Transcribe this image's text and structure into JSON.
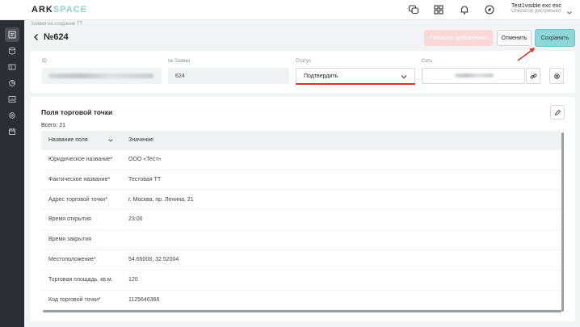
{
  "header": {
    "logo_main": "ARK",
    "logo_accent": "SPACE",
    "user_name": "Test1visible exc exc",
    "user_role": "Оператор дистрибьютора"
  },
  "sidebar": {
    "items": [
      {
        "icon": "list-icon",
        "active": true
      },
      {
        "icon": "database-icon",
        "active": false
      },
      {
        "icon": "layout-icon",
        "active": false
      },
      {
        "icon": "chart-icon",
        "active": false
      },
      {
        "icon": "report-icon",
        "active": false
      },
      {
        "icon": "settings-icon",
        "active": false
      },
      {
        "icon": "calendar-icon",
        "active": false
      }
    ]
  },
  "page": {
    "breadcrumb": "Заявки на создание ТТ",
    "title": "№624"
  },
  "toolbar": {
    "disabled_label": "Показать добавление",
    "cancel_label": "Отменить",
    "save_label": "Сохранить"
  },
  "fields": {
    "id_label": "ID",
    "order_label": "№ Заявки",
    "order_value": "624",
    "status_label": "Статус",
    "status_value": "Подтвердить",
    "network_label": "Сеть"
  },
  "section": {
    "title": "Поля торговой точки",
    "total": "Всего: 21"
  },
  "table": {
    "headers": [
      "Название поля",
      "Значение"
    ],
    "rows": [
      [
        "Юридическое название*",
        "ООО «Тест»"
      ],
      [
        "Фактическое название*",
        "Тестовая ТТ"
      ],
      [
        "Адрес торговой точки*",
        "г. Москва, пр. Ленина, 21"
      ],
      [
        "Время открытия",
        "23:00"
      ],
      [
        "Время закрытия",
        ""
      ],
      [
        "Местоположение*",
        "54.65008, 32.52004"
      ],
      [
        "Торговая площадь, кв.м.",
        "120"
      ],
      [
        "Код торговой точки*",
        "1125646366"
      ]
    ]
  },
  "colors": {
    "accent": "#8fd6d9",
    "annotation": "#d9332f",
    "sidebar": "#2b2e33"
  }
}
